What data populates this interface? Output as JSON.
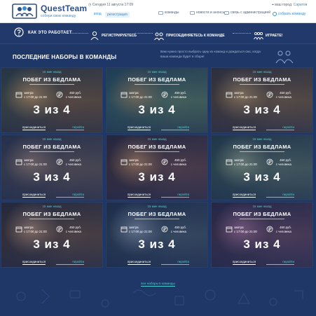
{
  "header": {
    "brand": "QuestTeam",
    "tagline": "собери свою команду",
    "date": "Сегодня 11 августа 17:09",
    "login": "вход",
    "register": "регистрация",
    "nav": [
      "команды",
      "новости и анонсы",
      "связь с администрацией"
    ],
    "city_label": "ваш город:",
    "city": "Саратов",
    "collect": "собрать команду"
  },
  "how": {
    "title": "КАК ЭТО РАБОТАЕТ",
    "steps": [
      "РЕГИСТРИРУЕТЕСЬ",
      "ПРИСОЕДИНЯЕТЕСЬ К КОМАНДЕ",
      "ИГРАЕТЕ!"
    ]
  },
  "recruit": {
    "title": "ПОСЛЕДНИЕ НАБОРЫ В КОМАНДЫ",
    "note": "Вам нужно просто выбрать одну из команд и дождаться смс, когда ваша команда будет в сборе!"
  },
  "cards": [
    {
      "team": "15 мин назад",
      "title": "ПОБЕГ ИЗ БЕДЛАМА",
      "day": "завтра",
      "time": "с 17:00 до 21:00",
      "price": "450 руб.",
      "per": "с человека",
      "count": "3 из 4",
      "join": "присоединиться",
      "go": "перейти"
    },
    {
      "team": "15 мин назад",
      "title": "ПОБЕГ ИЗ БЕДЛАМА",
      "day": "завтра",
      "time": "с 17:00 до 21:00",
      "price": "450 руб.",
      "per": "с человека",
      "count": "3 из 4",
      "join": "присоединиться",
      "go": "перейти"
    },
    {
      "team": "15 мин назад",
      "title": "ПОБЕГ ИЗ БЕДЛАМА",
      "day": "завтра",
      "time": "с 17:00 до 21:00",
      "price": "450 руб.",
      "per": "с человека",
      "count": "3 из 4",
      "join": "присоединиться",
      "go": "перейти"
    },
    {
      "team": "15 мин назад",
      "title": "ПОБЕГ ИЗ БЕДЛАМА",
      "day": "завтра",
      "time": "с 17:00 до 21:00",
      "price": "450 руб.",
      "per": "с человека",
      "count": "3 из 4",
      "join": "присоединиться",
      "go": "перейти"
    },
    {
      "team": "15 мин назад",
      "title": "ПОБЕГ ИЗ БЕДЛАМА",
      "day": "завтра",
      "time": "с 17:00 до 21:00",
      "price": "450 руб.",
      "per": "с человека",
      "count": "3 из 4",
      "join": "присоединиться",
      "go": "перейти"
    },
    {
      "team": "15 мин назад",
      "title": "ПОБЕГ ИЗ БЕДЛАМА",
      "day": "завтра",
      "time": "с 17:00 до 21:00",
      "price": "450 руб.",
      "per": "с человека",
      "count": "3 из 4",
      "join": "присоединиться",
      "go": "перейти"
    },
    {
      "team": "15 мин назад",
      "title": "ПОБЕГ ИЗ БЕДЛАМА",
      "day": "завтра",
      "time": "с 17:00 до 21:00",
      "price": "450 руб.",
      "per": "с человека",
      "count": "3 из 4",
      "join": "присоединиться",
      "go": "перейти"
    },
    {
      "team": "15 мин назад",
      "title": "ПОБЕГ ИЗ БЕДЛАМА",
      "day": "завтра",
      "time": "с 17:00 до 21:00",
      "price": "450 руб.",
      "per": "с человека",
      "count": "3 из 4",
      "join": "присоединиться",
      "go": "перейти"
    },
    {
      "team": "15 мин назад",
      "title": "ПОБЕГ ИЗ БЕДЛАМА",
      "day": "завтра",
      "time": "с 17:00 до 21:00",
      "price": "450 руб.",
      "per": "с человека",
      "count": "3 из 4",
      "join": "присоединиться",
      "go": "перейти"
    }
  ],
  "all_link": "все наборы в команды",
  "colors": {
    "accent": "#4ad1d1",
    "brand": "#2f4f86",
    "link": "#3a8fd1",
    "page_bg": "#1f3766"
  }
}
